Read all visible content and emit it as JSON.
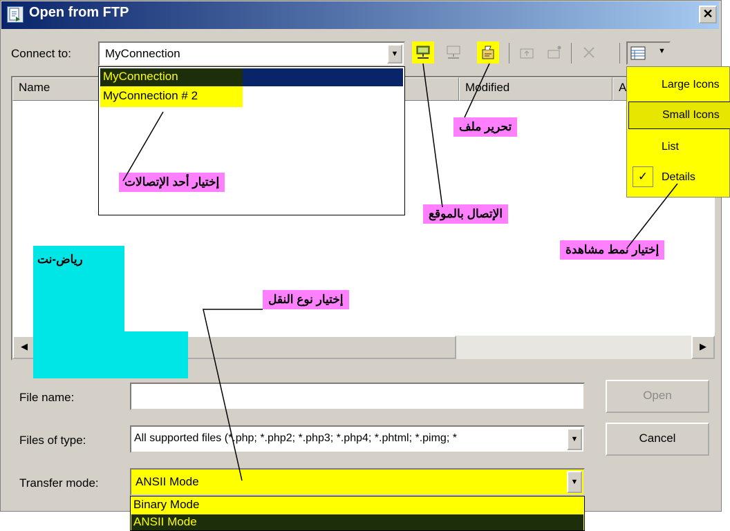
{
  "window": {
    "title": "Open from FTP",
    "close_glyph": "✕"
  },
  "connect": {
    "label": "Connect to:",
    "value": "MyConnection",
    "options": [
      "MyConnection",
      "MyConnection # 2"
    ]
  },
  "columns": [
    "Name",
    "Modified",
    "A"
  ],
  "view_menu": {
    "items": [
      "Large Icons",
      "Small Icons",
      "List",
      "Details"
    ],
    "checked": "Details"
  },
  "annotations": {
    "choose_connection": "إختيار أحد الإتصالات",
    "edit_file": "تحرير ملف",
    "connect_site": "الإتصال بالموقع",
    "view_mode": "إختيار نمط مشاهدة",
    "transfer_type": "إختيار نوع النقل",
    "watermark": "رياض-نت"
  },
  "form": {
    "file_name_label": "File name:",
    "file_name_value": "",
    "files_type_label": "Files of type:",
    "files_type_value": "All supported files (*.php; *.php2; *.php3; *.php4; *.phtml; *.pimg; *",
    "transfer_label": "Transfer mode:",
    "transfer_value": "ANSII Mode",
    "transfer_options": [
      "Binary Mode",
      "ANSII Mode"
    ]
  },
  "buttons": {
    "open": "Open",
    "cancel": "Cancel"
  },
  "colors": {
    "highlight": "#ffff00",
    "annotation_bg": "#ff80ff",
    "watermark_bg": "#00e5e5",
    "selection": "#0a246a"
  }
}
